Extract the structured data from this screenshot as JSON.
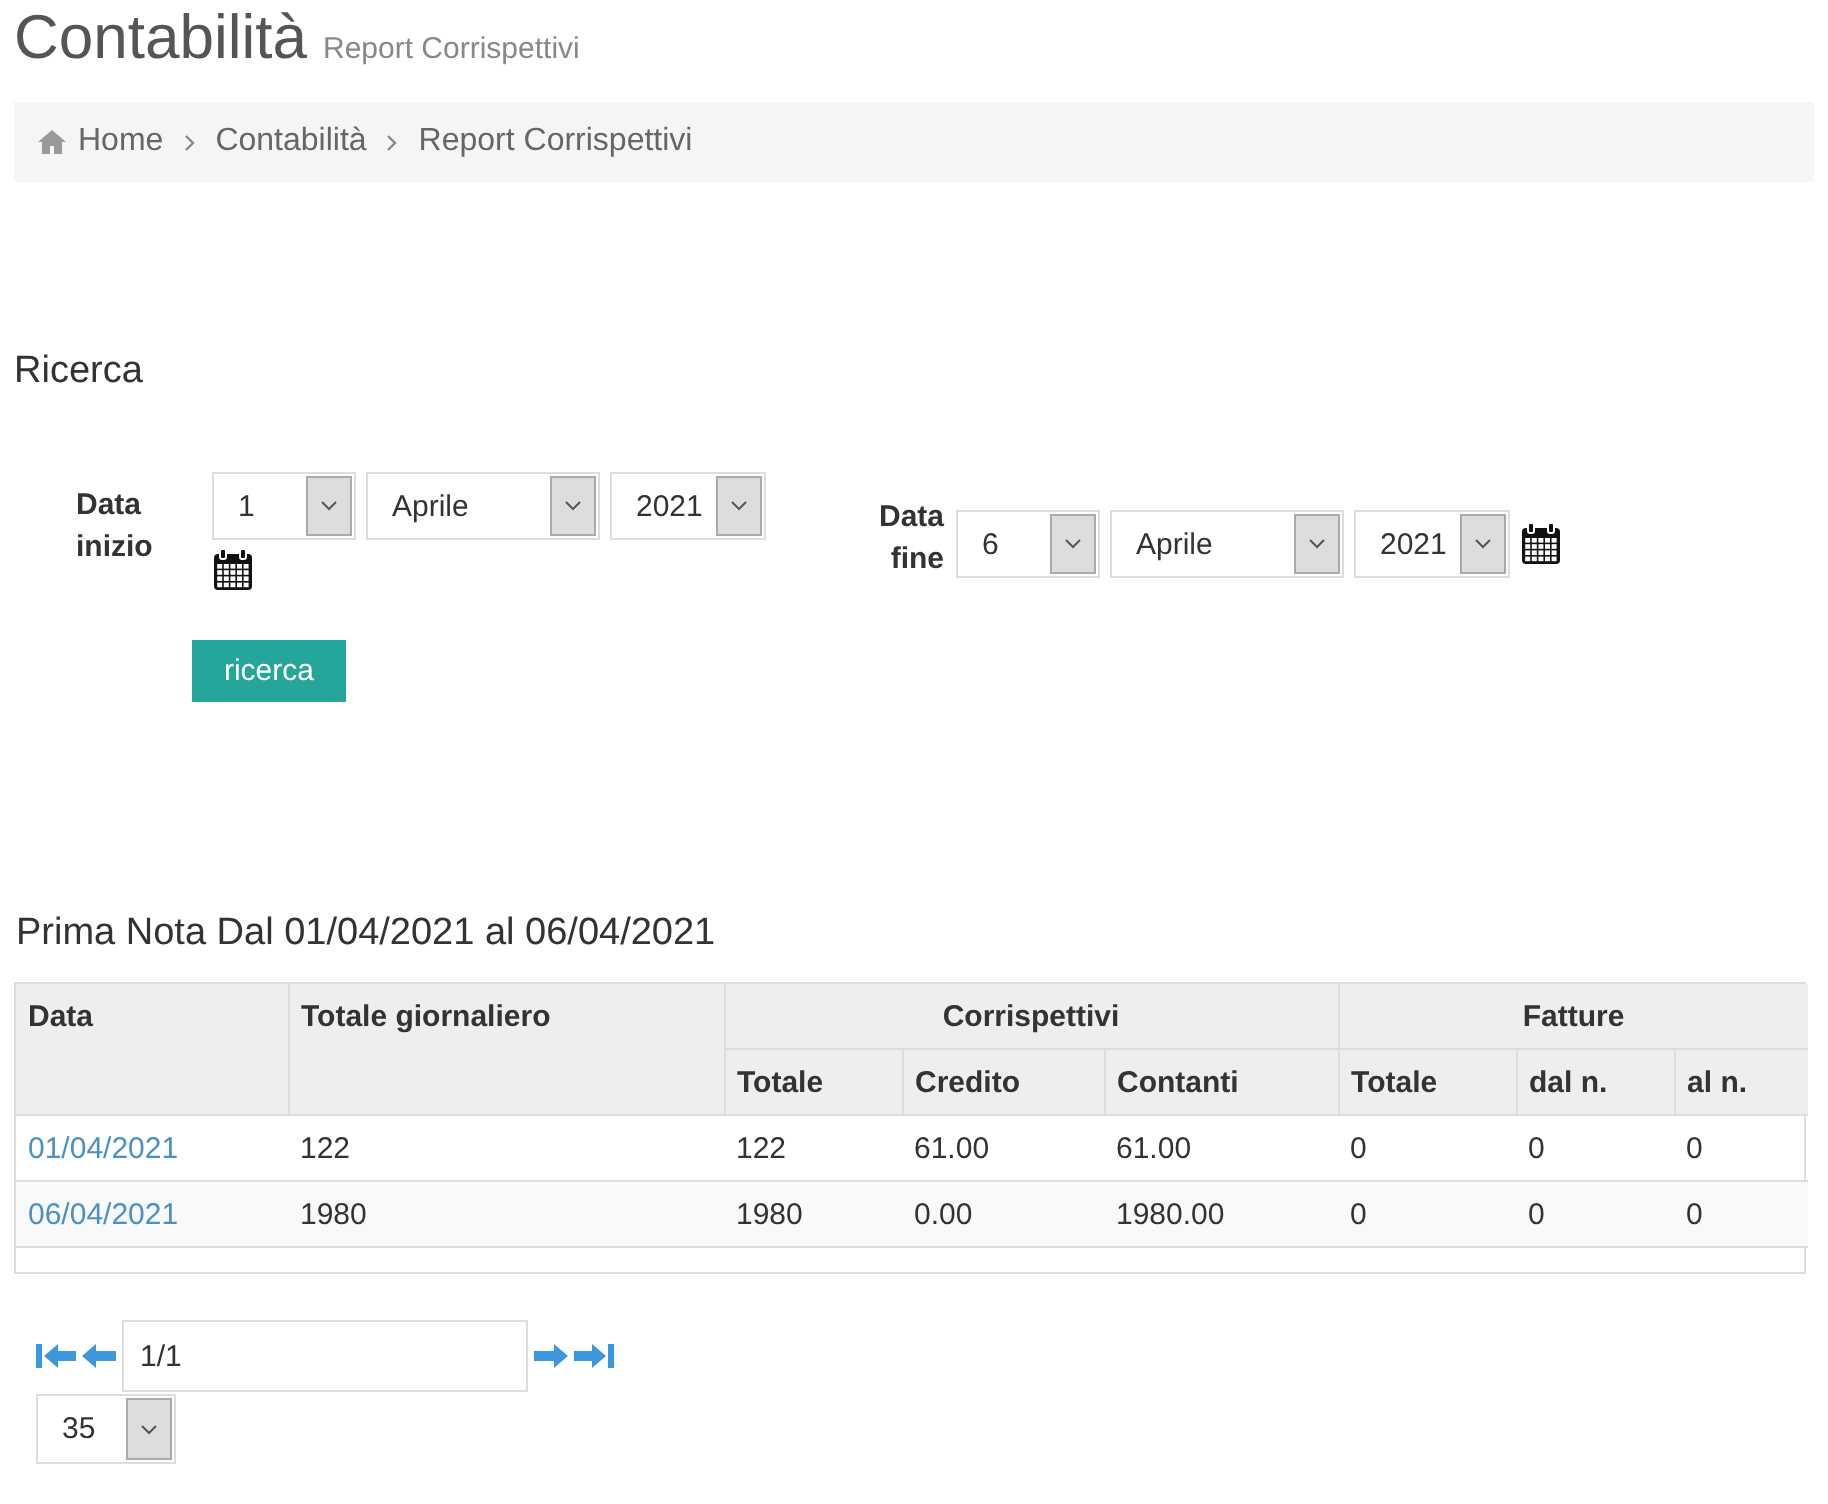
{
  "page": {
    "title": "Contabilità",
    "subtitle": "Report Corrispettivi"
  },
  "breadcrumb": [
    {
      "label": "Home",
      "kind": "home"
    },
    {
      "label": "Contabilità",
      "kind": "link"
    },
    {
      "label": "Report Corrispettivi",
      "kind": "current"
    }
  ],
  "search": {
    "title": "Ricerca",
    "ranges": [
      {
        "label": "Data inizio",
        "day": "1",
        "month": "Aprile",
        "year": "2021",
        "kind": "start"
      },
      {
        "label": "Data fine",
        "day": "6",
        "month": "Aprile",
        "year": "2021",
        "kind": "end"
      }
    ],
    "button": "ricerca"
  },
  "results": {
    "title": "Prima Nota Dal 01/04/2021 al 06/04/2021",
    "header_rows": [
      [
        "Data",
        "Totale giornaliero",
        "Corrispettivi",
        "Fatture"
      ],
      [
        "Totale",
        "Credito",
        "Contanti",
        "Totale",
        "dal n.",
        "al n."
      ]
    ],
    "rows": [
      [
        "01/04/2021",
        "122",
        "122",
        "61.00",
        "61.00",
        "0",
        "0",
        "0"
      ],
      [
        "06/04/2021",
        "1980",
        "1980",
        "0.00",
        "1980.00",
        "0",
        "0",
        "0"
      ]
    ]
  },
  "pagination": {
    "page": "1/1",
    "page_size": "35"
  }
}
